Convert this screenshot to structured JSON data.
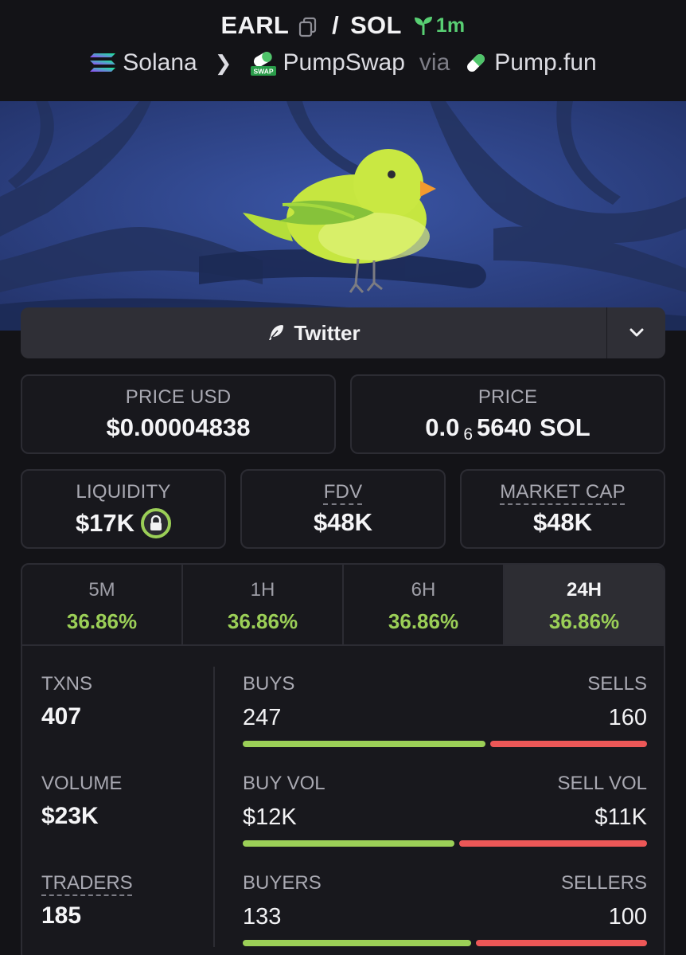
{
  "header": {
    "base_token": "EARL",
    "quote_token": "SOL",
    "separator": "/",
    "age": "1m",
    "chain": "Solana",
    "dex": "PumpSwap",
    "dex_badge": "SWAP",
    "via": "via",
    "launchpad": "Pump.fun"
  },
  "twitter": {
    "label": "Twitter"
  },
  "price_usd": {
    "label": "PRICE USD",
    "value": "$0.00004838"
  },
  "price_native": {
    "label": "PRICE",
    "prefix": "0.0",
    "zeros": "6",
    "digits": "5640",
    "unit": "SOL"
  },
  "liquidity": {
    "label": "LIQUIDITY",
    "value": "$17K"
  },
  "fdv": {
    "label": "FDV",
    "value": "$48K"
  },
  "market_cap": {
    "label": "MARKET CAP",
    "value": "$48K"
  },
  "tabs": [
    {
      "label": "5M",
      "change": "36.86%"
    },
    {
      "label": "1H",
      "change": "36.86%"
    },
    {
      "label": "6H",
      "change": "36.86%"
    },
    {
      "label": "24H",
      "change": "36.86%",
      "active": true
    }
  ],
  "txns": {
    "label": "TXNS",
    "value": "407"
  },
  "volume": {
    "label": "VOLUME",
    "value": "$23K"
  },
  "traders": {
    "label": "TRADERS",
    "value": "185"
  },
  "buys_sells": {
    "left_label": "BUYS",
    "right_label": "SELLS",
    "left_value": "247",
    "right_value": "160",
    "buy_fraction": 0.607
  },
  "buy_sell_vol": {
    "left_label": "BUY VOL",
    "right_label": "SELL VOL",
    "left_value": "$12K",
    "right_value": "$11K",
    "buy_fraction": 0.53
  },
  "buyers_sellers": {
    "left_label": "BUYERS",
    "right_label": "SELLERS",
    "left_value": "133",
    "right_value": "100",
    "buy_fraction": 0.571
  },
  "colors": {
    "positive": "#9bcf57",
    "negative": "#ec5757",
    "age": "#58cf73",
    "background": "#131317"
  }
}
